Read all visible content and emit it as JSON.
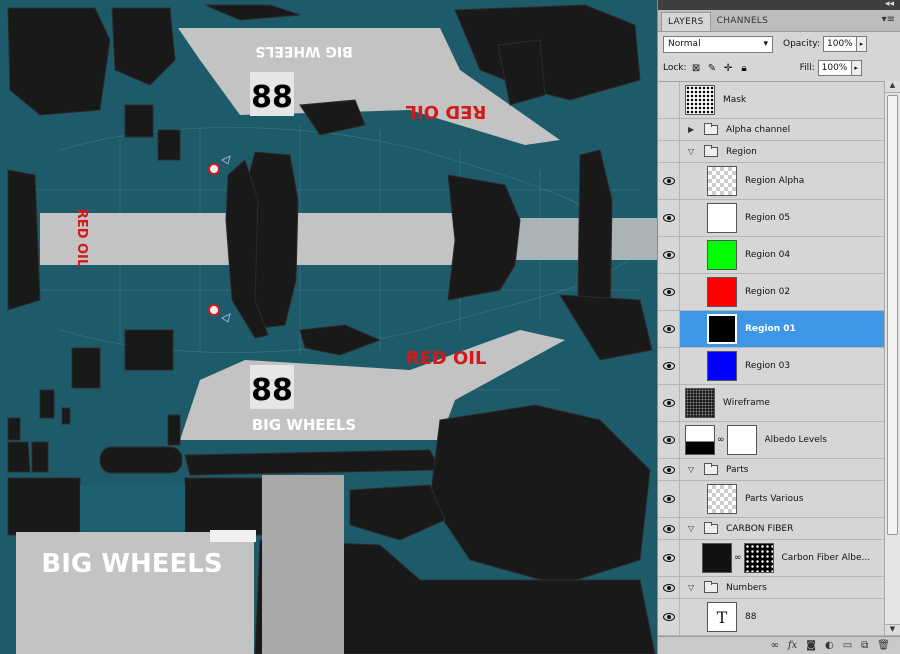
{
  "canvas": {
    "texts": {
      "big_wheels_top": "BIG WHEELS",
      "number_top": "88",
      "red_oil_top": "RED OIL",
      "red_oil_side": "RED OIL",
      "number_bottom": "88",
      "big_wheels_mid": "BIG WHEELS",
      "red_oil_mid": "RED OIL",
      "big_wheels_large": "BIG WHEELS"
    },
    "colors": {
      "background": "#1d5b6b",
      "stripe": "#c3c3c3",
      "silhouette": "#191919",
      "accent_red": "#d21a1a"
    }
  },
  "panel": {
    "tabs": [
      {
        "label": "LAYERS"
      },
      {
        "label": "CHANNELS"
      }
    ],
    "blend_mode": "Normal",
    "opacity_label": "Opacity:",
    "opacity_value": "100%",
    "lock_label": "Lock:",
    "fill_label": "Fill:",
    "fill_value": "100%",
    "layers": [
      {
        "name": "Mask",
        "visible": false
      },
      {
        "name": "Alpha channel",
        "visible": false,
        "group": true,
        "expanded": false
      },
      {
        "name": "Region",
        "visible": false,
        "group": true,
        "expanded": true
      },
      {
        "name": "Region Alpha",
        "visible": true
      },
      {
        "name": "Region 05",
        "visible": true,
        "color": "#ffffff"
      },
      {
        "name": "Region 04",
        "visible": true,
        "color": "#00ff00"
      },
      {
        "name": "Region 02",
        "visible": true,
        "color": "#ff0000"
      },
      {
        "name": "Region 01",
        "visible": true,
        "color": "#000000",
        "selected": true
      },
      {
        "name": "Region 03",
        "visible": true,
        "color": "#0000ff"
      },
      {
        "name": "Wireframe",
        "visible": true
      },
      {
        "name": "Albedo Levels",
        "visible": true
      },
      {
        "name": "Parts",
        "visible": true,
        "group": true,
        "expanded": true
      },
      {
        "name": "Parts Various",
        "visible": true
      },
      {
        "name": "CARBON FIBER",
        "visible": true,
        "group": true,
        "expanded": true
      },
      {
        "name": "Carbon Fiber Albe...",
        "visible": true
      },
      {
        "name": "Numbers",
        "visible": true,
        "group": true,
        "expanded": true
      },
      {
        "name": "88",
        "visible": true,
        "type_layer": "T"
      }
    ],
    "bottom_icons": [
      "link-icon",
      "fx-icon",
      "mask-icon",
      "adjustment-icon",
      "new-group-icon",
      "new-layer-icon",
      "trash-icon"
    ],
    "accent": "#3d96e6"
  }
}
